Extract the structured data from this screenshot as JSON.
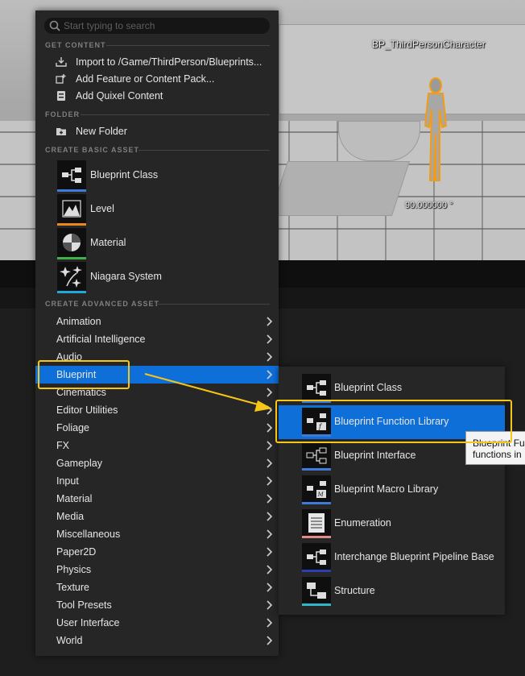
{
  "viewport": {
    "object_name": "BP_ThirdPersonCharacter",
    "rotation_readout": "90.000000 °"
  },
  "search": {
    "placeholder": "Start typing to search"
  },
  "sections": {
    "get_content": "GET CONTENT",
    "folder": "FOLDER",
    "create_basic": "CREATE BASIC ASSET",
    "create_advanced": "CREATE ADVANCED ASSET"
  },
  "get_content_items": [
    {
      "label": "Import to /Game/ThirdPerson/Blueprints...",
      "icon": "import-icon"
    },
    {
      "label": "Add Feature or Content Pack...",
      "icon": "content-pack-icon"
    },
    {
      "label": "Add Quixel Content",
      "icon": "quixel-icon"
    }
  ],
  "folder_items": [
    {
      "label": "New Folder",
      "icon": "new-folder-icon"
    }
  ],
  "basic_assets": [
    {
      "label": "Blueprint Class",
      "icon": "blueprint-class-icon",
      "color": "#3e7bd8"
    },
    {
      "label": "Level",
      "icon": "level-icon",
      "color": "#e8891c"
    },
    {
      "label": "Material",
      "icon": "material-icon",
      "color": "#3fb14a"
    },
    {
      "label": "Niagara System",
      "icon": "niagara-icon",
      "color": "#1fa9d9"
    }
  ],
  "advanced_categories": [
    "Animation",
    "Artificial Intelligence",
    "Audio",
    "Blueprint",
    "Cinematics",
    "Editor Utilities",
    "Foliage",
    "FX",
    "Gameplay",
    "Input",
    "Material",
    "Media",
    "Miscellaneous",
    "Paper2D",
    "Physics",
    "Texture",
    "Tool Presets",
    "User Interface",
    "World"
  ],
  "selected_category": "Blueprint",
  "blueprint_submenu": [
    {
      "label": "Blueprint Class",
      "icon": "blueprint-class-icon",
      "color": "#3e7bd8"
    },
    {
      "label": "Blueprint Function Library",
      "icon": "function-library-icon",
      "color": "#3e7bd8"
    },
    {
      "label": "Blueprint Interface",
      "icon": "blueprint-interface-icon",
      "color": "#3e7bd8"
    },
    {
      "label": "Blueprint Macro Library",
      "icon": "macro-library-icon",
      "color": "#3e7bd8"
    },
    {
      "label": "Enumeration",
      "icon": "enumeration-icon",
      "color": "#e08a8a"
    },
    {
      "label": "Interchange Blueprint Pipeline Base",
      "icon": "pipeline-icon",
      "color": "#2a3fb5"
    },
    {
      "label": "Structure",
      "icon": "structure-icon",
      "color": "#2db7c9"
    }
  ],
  "selected_submenu_item": "Blueprint Function Library",
  "tooltip": {
    "line1": "Blueprint Fu",
    "line2": "functions in"
  },
  "colors": {
    "highlight": "#0f6fd9",
    "annotation": "#f5c518"
  }
}
